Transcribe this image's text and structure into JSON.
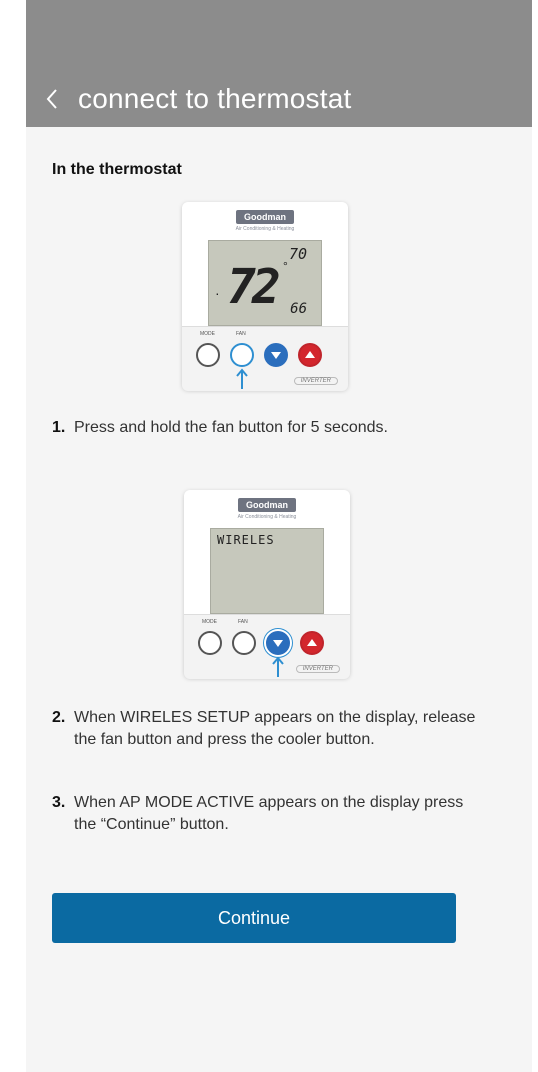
{
  "header": {
    "title": "connect to thermostat",
    "back_icon": "chevron-left-icon"
  },
  "section_title": "In the thermostat",
  "thermostat1": {
    "brand": "Goodman",
    "brand_sub": "Air Conditioning & Heating",
    "lcd_main": "72",
    "lcd_setpoint": "70",
    "lcd_humidity": "66",
    "mode_label": "MODE",
    "fan_label": "FAN",
    "inverter": "INVERTER"
  },
  "step1": {
    "num": "1.",
    "text": "Press and hold the fan button for 5 seconds."
  },
  "thermostat2": {
    "brand": "Goodman",
    "brand_sub": "Air Conditioning & Heating",
    "lcd_text": "WIRELES",
    "mode_label": "MODE",
    "fan_label": "FAN",
    "inverter": "INVERTER"
  },
  "step2": {
    "num": "2.",
    "text": "When WIRELES SETUP appears on the display, release the fan button and press the cooler button."
  },
  "step3": {
    "num": "3.",
    "text": "When AP MODE ACTIVE appears on the display press the “Continue” button."
  },
  "continue_label": "Continue",
  "colors": {
    "header": "#8c8c8c",
    "button": "#0b6aa2",
    "arrow": "#2e8fd1"
  }
}
